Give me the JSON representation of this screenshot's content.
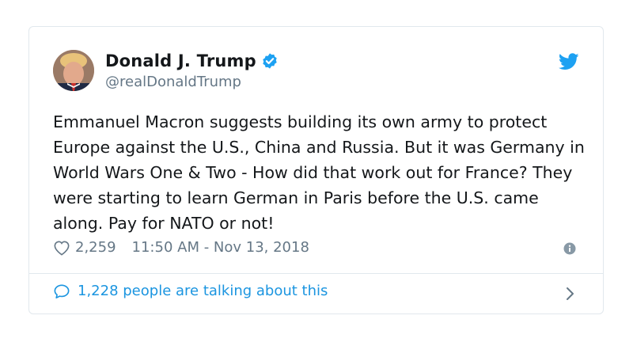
{
  "tweet": {
    "author_name": "Donald J. Trump",
    "handle": "@realDonaldTrump",
    "text": "Emmanuel Macron suggests building its own army to protect Europe against the U.S., China and Russia. But it was Germany in World Wars One & Two - How did that work out for France? They were starting to learn German in Paris before the U.S. came along. Pay for NATO or not!",
    "likes": "2,259",
    "timestamp": "11:50 AM - Nov 13, 2018",
    "talking_about": "1,228 people are talking about this"
  },
  "icons": {
    "verified": "verified-badge-icon",
    "brand": "twitter-bird-icon",
    "like": "heart-icon",
    "info": "info-icon",
    "reply": "speech-bubble-icon",
    "more": "chevron-right-icon"
  },
  "colors": {
    "accent": "#1da1f2",
    "link": "#1b95e0",
    "muted": "#657786",
    "border": "#e1e8ed",
    "text": "#14171a"
  }
}
